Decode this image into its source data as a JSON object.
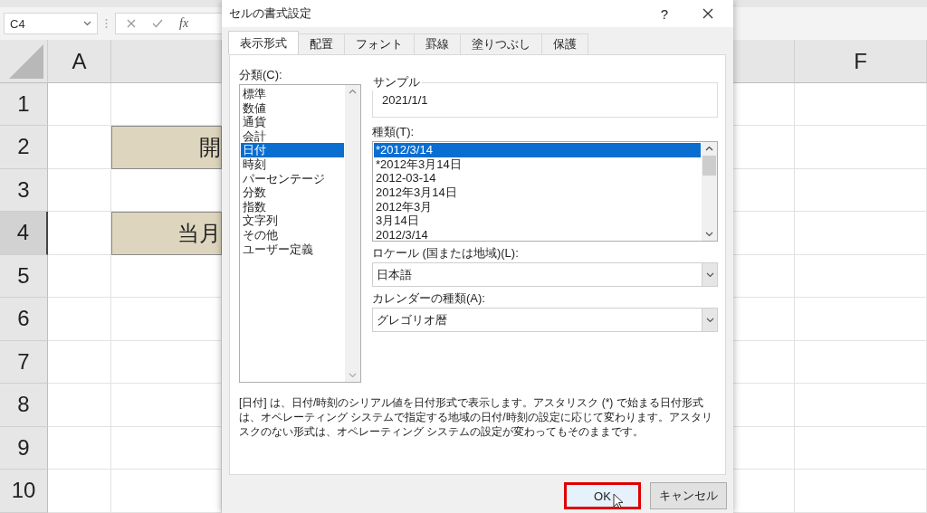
{
  "spreadsheet": {
    "name_box": "C4",
    "function_label": "fx",
    "columns": [
      {
        "label": "A"
      },
      {
        "label": "F"
      }
    ],
    "rows": [
      {
        "label": "1",
        "selected": false
      },
      {
        "label": "2",
        "selected": false,
        "cell": "開"
      },
      {
        "label": "3",
        "selected": false
      },
      {
        "label": "4",
        "selected": true,
        "cell": "当月"
      },
      {
        "label": "5",
        "selected": false
      },
      {
        "label": "6",
        "selected": false
      },
      {
        "label": "7",
        "selected": false
      },
      {
        "label": "8",
        "selected": false
      },
      {
        "label": "9",
        "selected": false
      },
      {
        "label": "10",
        "selected": false
      }
    ]
  },
  "dialog": {
    "title": "セルの書式設定",
    "help": "?",
    "tabs": [
      {
        "label": "表示形式",
        "selected": true
      },
      {
        "label": "配置",
        "selected": false
      },
      {
        "label": "フォント",
        "selected": false
      },
      {
        "label": "罫線",
        "selected": false
      },
      {
        "label": "塗りつぶし",
        "selected": false
      },
      {
        "label": "保護",
        "selected": false
      }
    ],
    "category_label": "分類(C):",
    "categories": [
      {
        "label": "標準",
        "selected": false
      },
      {
        "label": "数値",
        "selected": false
      },
      {
        "label": "通貨",
        "selected": false
      },
      {
        "label": "会計",
        "selected": false
      },
      {
        "label": "日付",
        "selected": true
      },
      {
        "label": "時刻",
        "selected": false
      },
      {
        "label": "パーセンテージ",
        "selected": false
      },
      {
        "label": "分数",
        "selected": false
      },
      {
        "label": "指数",
        "selected": false
      },
      {
        "label": "文字列",
        "selected": false
      },
      {
        "label": "その他",
        "selected": false
      },
      {
        "label": "ユーザー定義",
        "selected": false
      }
    ],
    "sample_label": "サンプル",
    "sample": "2021/1/1",
    "type_label": "種類(T):",
    "types": [
      {
        "label": "*2012/3/14",
        "selected": true
      },
      {
        "label": "*2012年3月14日",
        "selected": false
      },
      {
        "label": "2012-03-14",
        "selected": false
      },
      {
        "label": "2012年3月14日",
        "selected": false
      },
      {
        "label": "2012年3月",
        "selected": false
      },
      {
        "label": "3月14日",
        "selected": false
      },
      {
        "label": "2012/3/14",
        "selected": false
      }
    ],
    "locale_label": "ロケール (国または地域)(L):",
    "locale": "日本語",
    "calendar_label": "カレンダーの種類(A):",
    "calendar": "グレゴリオ暦",
    "description": "[日付] は、日付/時刻のシリアル値を日付形式で表示します。アスタリスク (*) で始まる日付形式は、オペレーティング システムで指定する地域の日付/時刻の設定に応じて変わります。アスタリスクのない形式は、オペレーティング システムの設定が変わってもそのままです。",
    "buttons": [
      {
        "label": "OK",
        "highlighted": true
      },
      {
        "label": "キャンセル",
        "highlighted": false
      }
    ]
  }
}
